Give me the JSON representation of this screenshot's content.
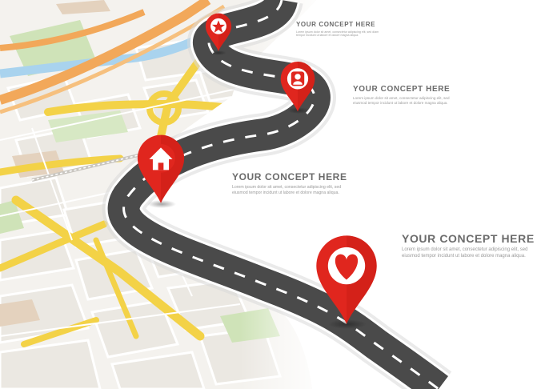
{
  "concepts": [
    {
      "title": "YOUR CONCEPT HERE",
      "body": "Lorem ipsum dolor sit amet, consectetur adipiscing elit, sed diam tempor incidunt ut labore et dolore magna aliqua."
    },
    {
      "title": "YOUR CONCEPT HERE",
      "body": "Lorem ipsum dolor sit amet, consectetur adipiscing elit, sed eiusmod tempor incidunt ut labore et dolore magna aliqua."
    },
    {
      "title": "YOUR CONCEPT HERE",
      "body": "Lorem ipsum dolor sit amet, consectetur adipiscing elit, sed eiusmod tempor incidunt ut labore et dolore magna aliqua."
    },
    {
      "title": "YOUR CONCEPT HERE",
      "body": "Lorem ipsum dolor sit amet, consectetur adipiscing elit, sed eiusmod tempor incidunt ut labore et dolore magna aliqua."
    }
  ],
  "pins": [
    {
      "icon": "star-icon"
    },
    {
      "icon": "person-icon"
    },
    {
      "icon": "home-icon"
    },
    {
      "icon": "heart-icon"
    }
  ],
  "colors": {
    "road": "#4a4a4a",
    "road_edge": "#ffffff",
    "pin": "#e0261e",
    "pin_light": "#ff5a4a",
    "map_base": "#f4f2ee",
    "map_road_yellow": "#f3d247",
    "map_road_orange": "#f2a85a",
    "river": "#a9d3ee",
    "park": "#cfe3b8",
    "block_tan": "#e4d2be",
    "text": "#6b6b6b"
  }
}
